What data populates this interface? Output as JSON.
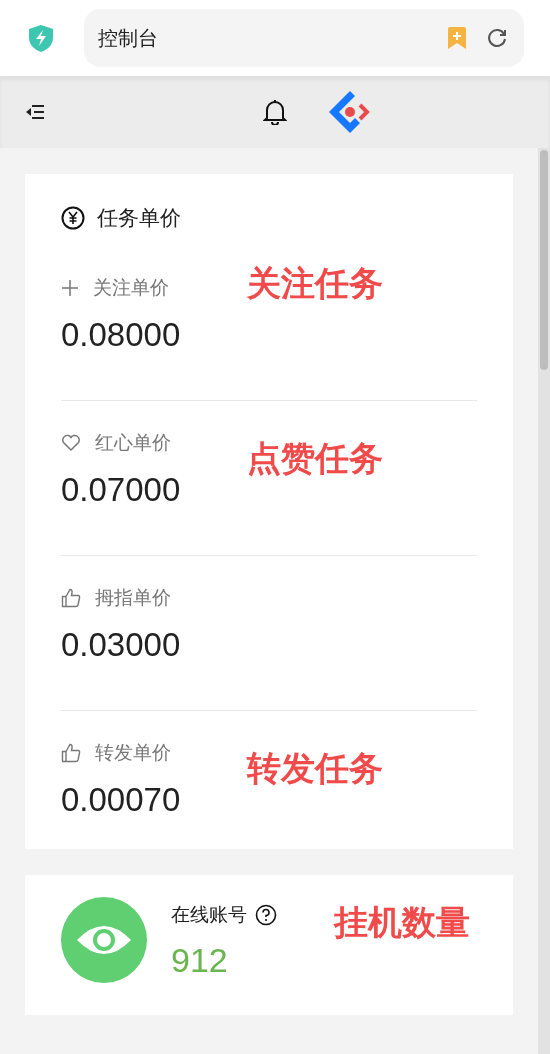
{
  "browser": {
    "address": "控制台"
  },
  "section": {
    "title": "任务单价",
    "items": [
      {
        "kind": "follow",
        "label": "关注单价",
        "value": "0.08000",
        "annotation": "关注任务"
      },
      {
        "kind": "heart",
        "label": "红心单价",
        "value": "0.07000",
        "annotation": "点赞任务"
      },
      {
        "kind": "thumb",
        "label": "拇指单价",
        "value": "0.03000"
      },
      {
        "kind": "thumb",
        "label": "转发单价",
        "value": "0.00070",
        "annotation": "转发任务"
      }
    ]
  },
  "stat": {
    "label": "在线账号",
    "value": "912",
    "annotation": "挂机数量"
  }
}
